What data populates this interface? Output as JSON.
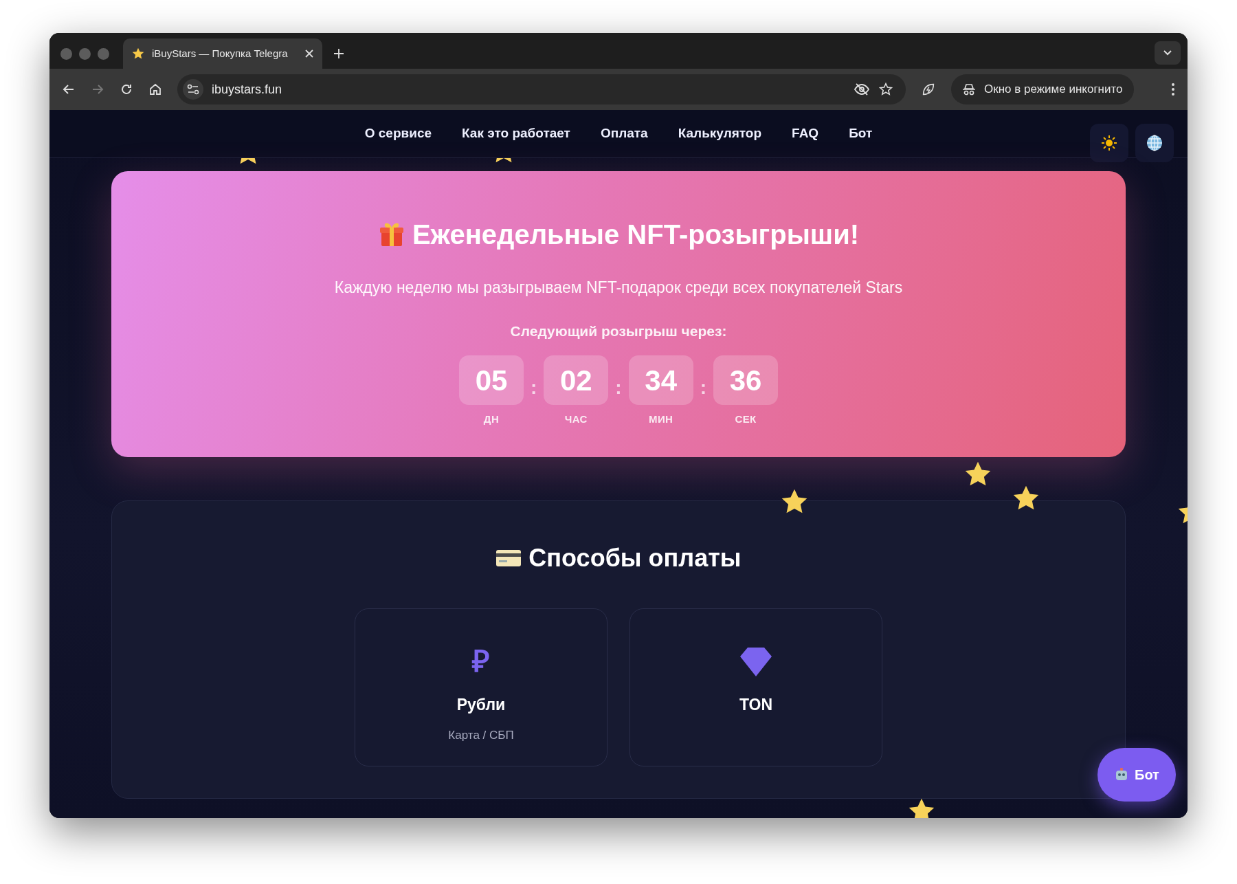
{
  "browser": {
    "tab": {
      "title": "iBuyStars — Покупка Telegra"
    },
    "address": "ibuystars.fun",
    "incognito_label": "Окно в режиме инкогнито"
  },
  "nav": {
    "items": [
      "О сервисе",
      "Как это работает",
      "Оплата",
      "Калькулятор",
      "FAQ",
      "Бот"
    ]
  },
  "banner": {
    "title": "Еженедельные NFT-розыгрыши!",
    "subtitle": "Каждую неделю мы разыгрываем NFT-подарок среди всех покупателей Stars",
    "countdown_label": "Следующий розыгрыш через:",
    "countdown": [
      {
        "value": "05",
        "unit": "ДН"
      },
      {
        "value": "02",
        "unit": "ЧАС"
      },
      {
        "value": "34",
        "unit": "МИН"
      },
      {
        "value": "36",
        "unit": "СЕК"
      }
    ],
    "separators": [
      ":",
      ":",
      ":"
    ]
  },
  "payment": {
    "title": "Способы оплаты",
    "methods": [
      {
        "kind": "ruble",
        "symbol": "₽",
        "name": "Рубли",
        "note": "Карта / СБП"
      },
      {
        "kind": "ton",
        "name": "TON"
      }
    ]
  },
  "bot_button": {
    "label": "Бот"
  }
}
